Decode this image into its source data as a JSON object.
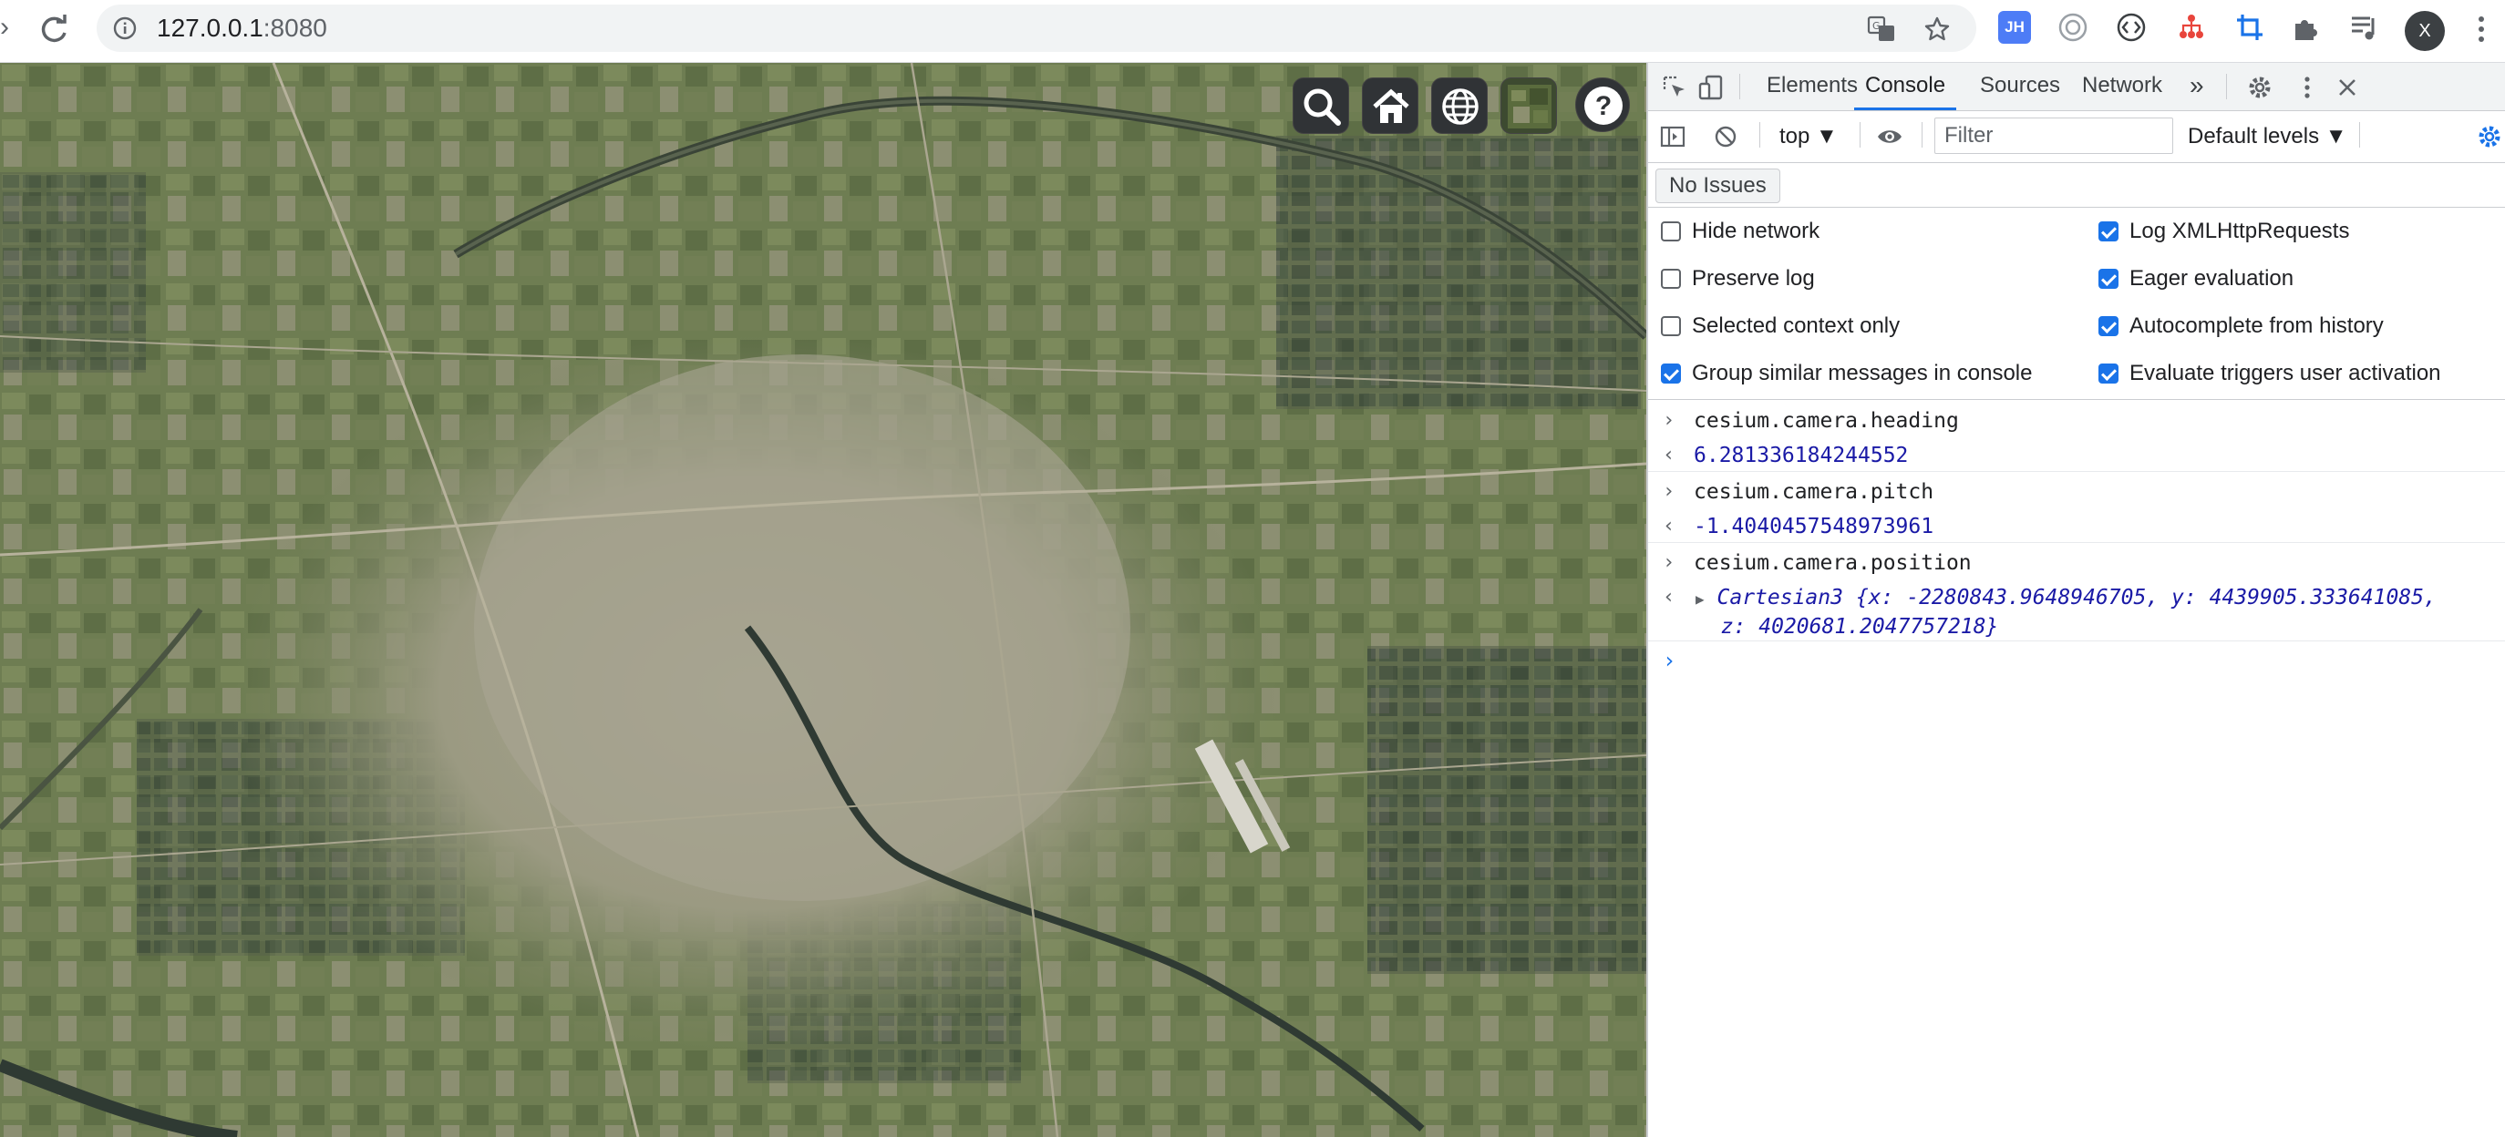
{
  "browser": {
    "url_host": "127.0.0.1",
    "url_port": ":8080",
    "extension_label": "JH",
    "avatar_initial": "X"
  },
  "map": {
    "toolbar": [
      "search-icon",
      "home-icon",
      "globe-icon",
      "imagery-layer-icon",
      "help-icon"
    ],
    "help_glyph": "?"
  },
  "devtools": {
    "tabs": [
      "Elements",
      "Console",
      "Sources",
      "Network"
    ],
    "active_tab": "Console",
    "more_tabs": "»",
    "context": "top ▼",
    "filter_placeholder": "Filter",
    "levels": "Default levels ▼",
    "issues": "No Issues",
    "settings_left": [
      {
        "label": "Hide network",
        "checked": false
      },
      {
        "label": "Preserve log",
        "checked": false
      },
      {
        "label": "Selected context only",
        "checked": false
      },
      {
        "label": "Group similar messages in console",
        "checked": true
      }
    ],
    "settings_right": [
      {
        "label": "Log XMLHttpRequests",
        "checked": true
      },
      {
        "label": "Eager evaluation",
        "checked": true
      },
      {
        "label": "Autocomplete from history",
        "checked": true
      },
      {
        "label": "Evaluate triggers user activation",
        "checked": true
      }
    ],
    "console": [
      {
        "type": "input",
        "text": "cesium.camera.heading"
      },
      {
        "type": "result",
        "text": "6.281336184244552"
      },
      {
        "type": "input",
        "text": "cesium.camera.pitch"
      },
      {
        "type": "result",
        "text": "-1.4040457548973961"
      },
      {
        "type": "input",
        "text": "cesium.camera.position"
      },
      {
        "type": "object",
        "class_name": "Cartesian3",
        "x": "-2280843.9648946705",
        "y": "4439905.333641085",
        "z": "4020681.2047757218"
      }
    ]
  }
}
